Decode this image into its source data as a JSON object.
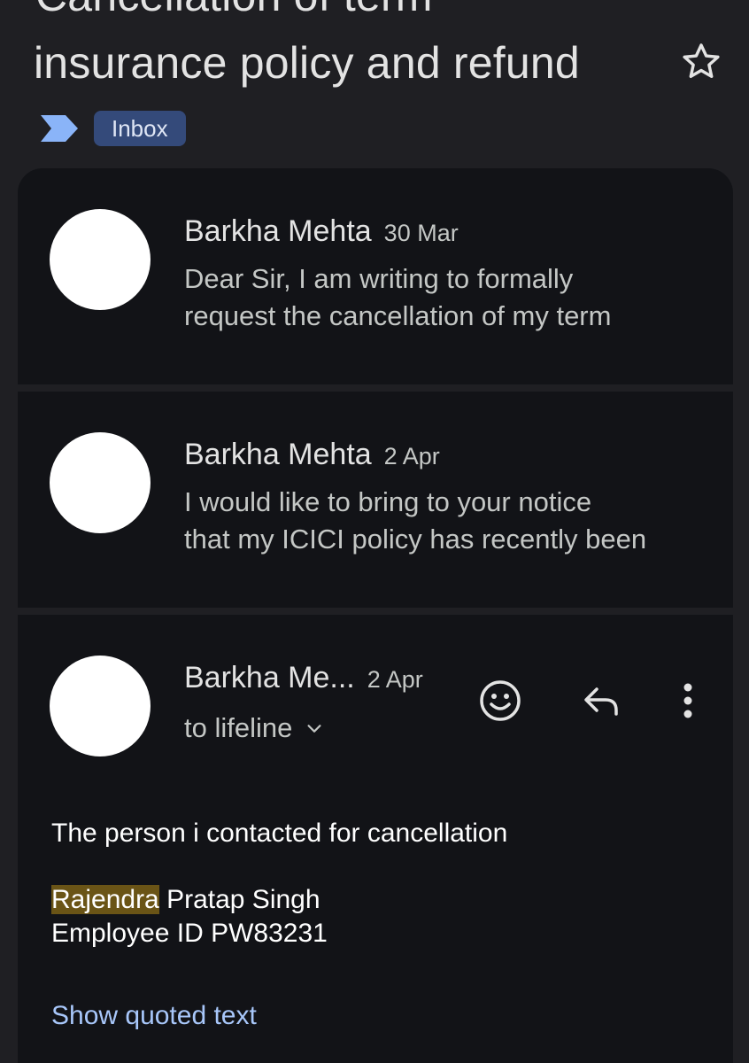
{
  "thread": {
    "subject_partial_top": "Cancellation of term",
    "subject_line": "insurance policy and refund",
    "label": "Inbox"
  },
  "messages": [
    {
      "sender": "Barkha Mehta",
      "date": "30 Mar",
      "snippet_line1": "Dear Sir, I am writing to formally",
      "snippet_line2": "request the cancellation of my term"
    },
    {
      "sender": "Barkha Mehta",
      "date": "2 Apr",
      "snippet_line1": "I would like to bring to your notice",
      "snippet_line2": "that my ICICI policy has recently been"
    }
  ],
  "expanded": {
    "sender": "Barkha Me...",
    "date": "2 Apr",
    "recipient": "to lifeline",
    "body_line1": "The person i contacted for cancellation",
    "body_name_highlight": "Rajendra",
    "body_name_rest": " Pratap Singh",
    "body_line3": "Employee ID PW83231",
    "show_quoted": "Show quoted text"
  },
  "icons": {
    "star": "star-outline-icon",
    "importance": "importance-marker-icon",
    "emoji": "emoji-reaction-icon",
    "reply": "reply-icon",
    "more": "more-vert-icon",
    "chevron": "chevron-down-icon"
  },
  "colors": {
    "background": "#1f1f23",
    "card": "#121317",
    "label_chip": "#344a7a",
    "importance_marker": "#8ab4f8",
    "highlight": "#6a5416",
    "link": "#a8c7fa"
  }
}
